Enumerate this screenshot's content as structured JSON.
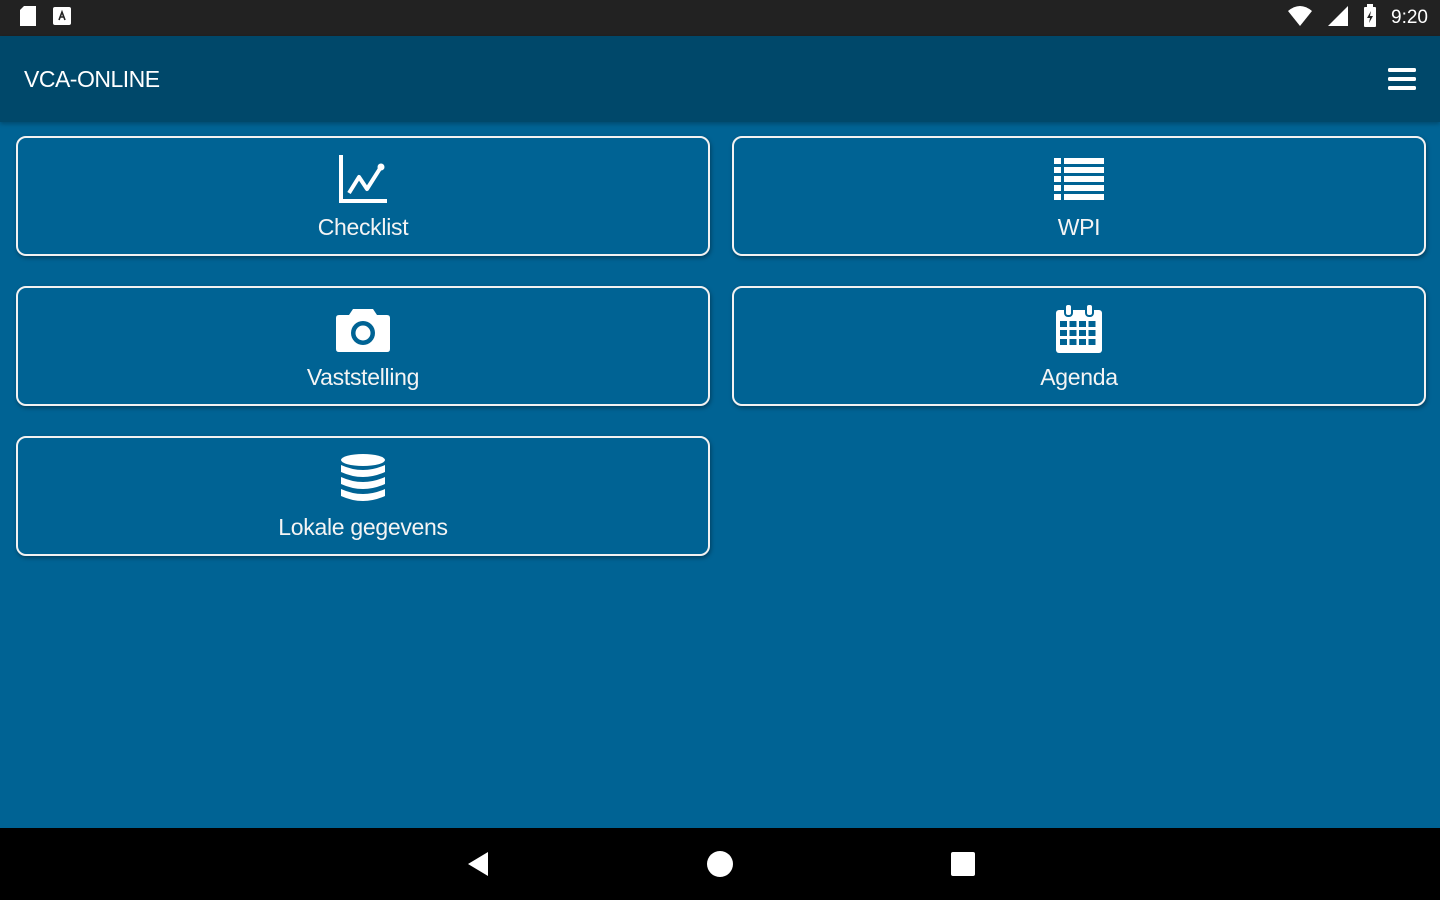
{
  "status_bar": {
    "time": "9:20",
    "left_icons": [
      "sd-card-icon",
      "android-notification-icon"
    ],
    "right_icons": [
      "wifi-icon",
      "cell-signal-icon",
      "battery-icon"
    ]
  },
  "app_bar": {
    "title": "VCA-ONLINE",
    "menu_icon": "hamburger-menu-icon"
  },
  "tiles": [
    {
      "label": "Checklist",
      "icon": "line-chart-icon"
    },
    {
      "label": "WPI",
      "icon": "list-icon"
    },
    {
      "label": "Vaststelling",
      "icon": "camera-icon"
    },
    {
      "label": "Agenda",
      "icon": "calendar-icon"
    },
    {
      "label": "Lokale gegevens",
      "icon": "database-icon"
    }
  ],
  "nav_bar": {
    "buttons": [
      "back-icon",
      "home-icon",
      "recents-icon"
    ]
  },
  "colors": {
    "background": "#006394",
    "app_bar": "#00486a",
    "status_bar": "#222222",
    "nav_bar": "#000000",
    "tile_border": "#f2f2f2"
  }
}
